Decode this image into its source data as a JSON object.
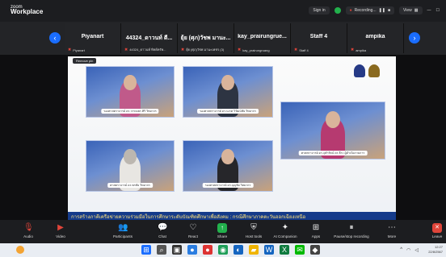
{
  "app": {
    "logo_top": "zoom",
    "logo_bottom": "Workplace"
  },
  "titlebar": {
    "sign_in": "Sign in",
    "recording": "Recording...",
    "view": "View"
  },
  "nav": {
    "prev": "‹",
    "next": "›"
  },
  "participants": [
    {
      "name": "Piyanart",
      "sub": "Piyanart"
    },
    {
      "name": "44324_ดาวนท์ ตี...",
      "sub": "44324_ดาวนท์ ทิพย์ทรัพ..."
    },
    {
      "name": "ยุ้ย (ศุภ)วัชพ มานะ...",
      "sub": "ยุ้ย (ศุภ)วัชพ มานะเพชร (3)"
    },
    {
      "name": "kay_prairungrue...",
      "sub": "kay_prairungruang"
    },
    {
      "name": "Staff 4",
      "sub": "Staff 4"
    },
    {
      "name": "ampika",
      "sub": "ampika"
    }
  ],
  "stage": {
    "remove_pin": "Remove pin",
    "captions": [
      "รองศาสตราจารย์ ดร.วรรณพร ศิริ\nวิทยากร",
      "รองศาสตราจารย์ ดร.นเรศ วิวัฒน์ชัย\nวิทยากร",
      "ศาสตราจารย์ ดร.พรชัย\nวิทยากร",
      "รองศาสตราจารย์ ดร.บุญชัย\nวิทยากร",
      "ศาสตราจารย์ ดร.จุฬารัตน์ ดร.ธีระ\nผู้ดำเนินรายการ"
    ],
    "banner": "การสร้างภาคีเครือข่ายความร่วมมือในการศึกษาระดับบัณฑิตศึกษาเพื่อสังคม : กรณีศึกษาภาคตะวันออกเฉียงเหนือ"
  },
  "toolbar": [
    {
      "label": "Audio",
      "icon": "mic-off-icon"
    },
    {
      "label": "Video",
      "icon": "video-off-icon"
    },
    {
      "label": "Participants",
      "icon": "participants-icon",
      "count": "75"
    },
    {
      "label": "Chat",
      "icon": "chat-icon",
      "count": "1"
    },
    {
      "label": "React",
      "icon": "react-icon"
    },
    {
      "label": "Share",
      "icon": "share-icon"
    },
    {
      "label": "Host tools",
      "icon": "shield-icon"
    },
    {
      "label": "AI Companion",
      "icon": "ai-companion-icon"
    },
    {
      "label": "Apps",
      "icon": "apps-icon"
    },
    {
      "label": "Pause/stop recording",
      "icon": "pause-stop-recording-icon"
    },
    {
      "label": "More",
      "icon": "more-icon"
    },
    {
      "label": "Leave",
      "icon": "leave-icon"
    }
  ],
  "taskbar": {
    "time": "12:27",
    "date": "22/8/2567"
  },
  "colors": {
    "accent_blue": "#1a6dff",
    "green": "#22b14c",
    "red": "#e0453a"
  }
}
